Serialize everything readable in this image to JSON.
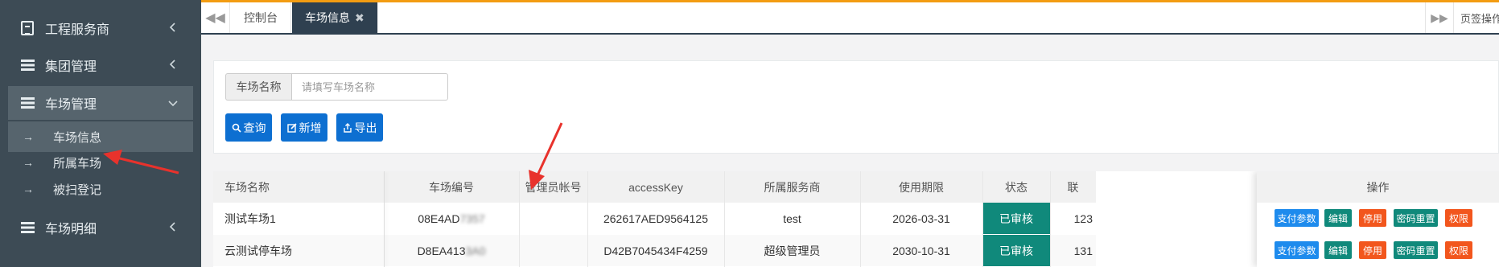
{
  "sidebar": {
    "menu": [
      {
        "label": "工程服务商",
        "icon": "document-icon"
      },
      {
        "label": "集团管理",
        "icon": "list-icon"
      },
      {
        "label": "车场管理",
        "icon": "list-icon"
      }
    ],
    "sub_items": [
      "车场信息",
      "所属车场",
      "被扫登记"
    ],
    "partial_item": "车场明细"
  },
  "tabs": {
    "items": [
      "控制台",
      "车场信息"
    ],
    "right_label": "页签操作"
  },
  "search": {
    "label": "车场名称",
    "placeholder": "请填写车场名称",
    "buttons": [
      "查询",
      "新增",
      "导出"
    ]
  },
  "table": {
    "headers": [
      "车场名称",
      "车场编号",
      "管理员帐号",
      "accessKey",
      "所属服务商",
      "使用期限",
      "状态",
      "联",
      "操作"
    ],
    "rows": [
      {
        "name": "测试车场1",
        "code": "08E4AD",
        "code_blur": "7357",
        "admin": "",
        "accessKey": "262617AED9564125",
        "provider": "test",
        "expiry": "2026-03-31",
        "status": "已审核",
        "phone": "123"
      },
      {
        "name": "云测试停车场",
        "code": "D8EA413",
        "code_blur": "3A0",
        "admin": "",
        "accessKey": "D42B7045434F4259",
        "provider": "超级管理员",
        "expiry": "2030-10-31",
        "status": "已审核",
        "phone": "131"
      }
    ],
    "actions": [
      "支付参数",
      "编辑",
      "停用",
      "密码重置",
      "权限"
    ]
  },
  "colors": {
    "sidebar_bg": "#3d4b55",
    "accent_orange": "#f39c12",
    "status_green": "#10897b",
    "primary_blue": "#0d6fd1",
    "annotation_red": "#e8322c"
  }
}
